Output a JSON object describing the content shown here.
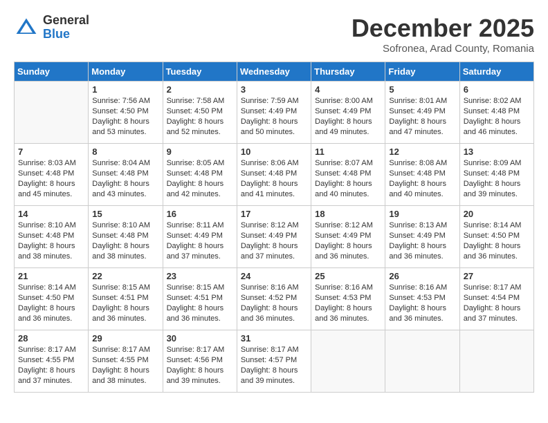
{
  "logo": {
    "general": "General",
    "blue": "Blue"
  },
  "title": "December 2025",
  "subtitle": "Sofronea, Arad County, Romania",
  "headers": [
    "Sunday",
    "Monday",
    "Tuesday",
    "Wednesday",
    "Thursday",
    "Friday",
    "Saturday"
  ],
  "weeks": [
    [
      {
        "day": "",
        "empty": true,
        "lines": []
      },
      {
        "day": "1",
        "empty": false,
        "lines": [
          "Sunrise: 7:56 AM",
          "Sunset: 4:50 PM",
          "Daylight: 8 hours",
          "and 53 minutes."
        ]
      },
      {
        "day": "2",
        "empty": false,
        "lines": [
          "Sunrise: 7:58 AM",
          "Sunset: 4:50 PM",
          "Daylight: 8 hours",
          "and 52 minutes."
        ]
      },
      {
        "day": "3",
        "empty": false,
        "lines": [
          "Sunrise: 7:59 AM",
          "Sunset: 4:49 PM",
          "Daylight: 8 hours",
          "and 50 minutes."
        ]
      },
      {
        "day": "4",
        "empty": false,
        "lines": [
          "Sunrise: 8:00 AM",
          "Sunset: 4:49 PM",
          "Daylight: 8 hours",
          "and 49 minutes."
        ]
      },
      {
        "day": "5",
        "empty": false,
        "lines": [
          "Sunrise: 8:01 AM",
          "Sunset: 4:49 PM",
          "Daylight: 8 hours",
          "and 47 minutes."
        ]
      },
      {
        "day": "6",
        "empty": false,
        "lines": [
          "Sunrise: 8:02 AM",
          "Sunset: 4:48 PM",
          "Daylight: 8 hours",
          "and 46 minutes."
        ]
      }
    ],
    [
      {
        "day": "7",
        "empty": false,
        "lines": [
          "Sunrise: 8:03 AM",
          "Sunset: 4:48 PM",
          "Daylight: 8 hours",
          "and 45 minutes."
        ]
      },
      {
        "day": "8",
        "empty": false,
        "lines": [
          "Sunrise: 8:04 AM",
          "Sunset: 4:48 PM",
          "Daylight: 8 hours",
          "and 43 minutes."
        ]
      },
      {
        "day": "9",
        "empty": false,
        "lines": [
          "Sunrise: 8:05 AM",
          "Sunset: 4:48 PM",
          "Daylight: 8 hours",
          "and 42 minutes."
        ]
      },
      {
        "day": "10",
        "empty": false,
        "lines": [
          "Sunrise: 8:06 AM",
          "Sunset: 4:48 PM",
          "Daylight: 8 hours",
          "and 41 minutes."
        ]
      },
      {
        "day": "11",
        "empty": false,
        "lines": [
          "Sunrise: 8:07 AM",
          "Sunset: 4:48 PM",
          "Daylight: 8 hours",
          "and 40 minutes."
        ]
      },
      {
        "day": "12",
        "empty": false,
        "lines": [
          "Sunrise: 8:08 AM",
          "Sunset: 4:48 PM",
          "Daylight: 8 hours",
          "and 40 minutes."
        ]
      },
      {
        "day": "13",
        "empty": false,
        "lines": [
          "Sunrise: 8:09 AM",
          "Sunset: 4:48 PM",
          "Daylight: 8 hours",
          "and 39 minutes."
        ]
      }
    ],
    [
      {
        "day": "14",
        "empty": false,
        "lines": [
          "Sunrise: 8:10 AM",
          "Sunset: 4:48 PM",
          "Daylight: 8 hours",
          "and 38 minutes."
        ]
      },
      {
        "day": "15",
        "empty": false,
        "lines": [
          "Sunrise: 8:10 AM",
          "Sunset: 4:48 PM",
          "Daylight: 8 hours",
          "and 38 minutes."
        ]
      },
      {
        "day": "16",
        "empty": false,
        "lines": [
          "Sunrise: 8:11 AM",
          "Sunset: 4:49 PM",
          "Daylight: 8 hours",
          "and 37 minutes."
        ]
      },
      {
        "day": "17",
        "empty": false,
        "lines": [
          "Sunrise: 8:12 AM",
          "Sunset: 4:49 PM",
          "Daylight: 8 hours",
          "and 37 minutes."
        ]
      },
      {
        "day": "18",
        "empty": false,
        "lines": [
          "Sunrise: 8:12 AM",
          "Sunset: 4:49 PM",
          "Daylight: 8 hours",
          "and 36 minutes."
        ]
      },
      {
        "day": "19",
        "empty": false,
        "lines": [
          "Sunrise: 8:13 AM",
          "Sunset: 4:49 PM",
          "Daylight: 8 hours",
          "and 36 minutes."
        ]
      },
      {
        "day": "20",
        "empty": false,
        "lines": [
          "Sunrise: 8:14 AM",
          "Sunset: 4:50 PM",
          "Daylight: 8 hours",
          "and 36 minutes."
        ]
      }
    ],
    [
      {
        "day": "21",
        "empty": false,
        "lines": [
          "Sunrise: 8:14 AM",
          "Sunset: 4:50 PM",
          "Daylight: 8 hours",
          "and 36 minutes."
        ]
      },
      {
        "day": "22",
        "empty": false,
        "lines": [
          "Sunrise: 8:15 AM",
          "Sunset: 4:51 PM",
          "Daylight: 8 hours",
          "and 36 minutes."
        ]
      },
      {
        "day": "23",
        "empty": false,
        "lines": [
          "Sunrise: 8:15 AM",
          "Sunset: 4:51 PM",
          "Daylight: 8 hours",
          "and 36 minutes."
        ]
      },
      {
        "day": "24",
        "empty": false,
        "lines": [
          "Sunrise: 8:16 AM",
          "Sunset: 4:52 PM",
          "Daylight: 8 hours",
          "and 36 minutes."
        ]
      },
      {
        "day": "25",
        "empty": false,
        "lines": [
          "Sunrise: 8:16 AM",
          "Sunset: 4:53 PM",
          "Daylight: 8 hours",
          "and 36 minutes."
        ]
      },
      {
        "day": "26",
        "empty": false,
        "lines": [
          "Sunrise: 8:16 AM",
          "Sunset: 4:53 PM",
          "Daylight: 8 hours",
          "and 36 minutes."
        ]
      },
      {
        "day": "27",
        "empty": false,
        "lines": [
          "Sunrise: 8:17 AM",
          "Sunset: 4:54 PM",
          "Daylight: 8 hours",
          "and 37 minutes."
        ]
      }
    ],
    [
      {
        "day": "28",
        "empty": false,
        "lines": [
          "Sunrise: 8:17 AM",
          "Sunset: 4:55 PM",
          "Daylight: 8 hours",
          "and 37 minutes."
        ]
      },
      {
        "day": "29",
        "empty": false,
        "lines": [
          "Sunrise: 8:17 AM",
          "Sunset: 4:55 PM",
          "Daylight: 8 hours",
          "and 38 minutes."
        ]
      },
      {
        "day": "30",
        "empty": false,
        "lines": [
          "Sunrise: 8:17 AM",
          "Sunset: 4:56 PM",
          "Daylight: 8 hours",
          "and 39 minutes."
        ]
      },
      {
        "day": "31",
        "empty": false,
        "lines": [
          "Sunrise: 8:17 AM",
          "Sunset: 4:57 PM",
          "Daylight: 8 hours",
          "and 39 minutes."
        ]
      },
      {
        "day": "",
        "empty": true,
        "lines": []
      },
      {
        "day": "",
        "empty": true,
        "lines": []
      },
      {
        "day": "",
        "empty": true,
        "lines": []
      }
    ]
  ]
}
